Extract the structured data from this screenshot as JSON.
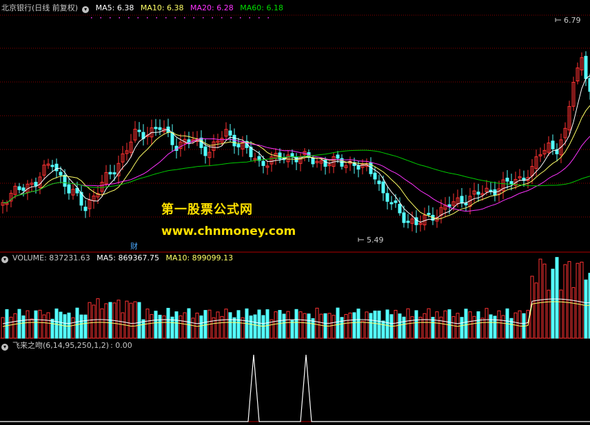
{
  "price_panel": {
    "stock_title": "北京银行(日线 前复权)",
    "indicators": [
      {
        "label": "MA5:",
        "value": "6.38",
        "color": "#ffffff"
      },
      {
        "label": "MA10:",
        "value": "6.38",
        "color": "#ffff66"
      },
      {
        "label": "MA20:",
        "value": "6.28",
        "color": "#ff33ff"
      },
      {
        "label": "MA60:",
        "value": "6.18",
        "color": "#00dd00"
      }
    ],
    "high_label": "6.79",
    "low_label": "5.49",
    "event_marker": "财"
  },
  "watermark": {
    "title": "第一股票公式网",
    "url": "www.chnmoney.com"
  },
  "volume_panel": {
    "label": "VOLUME: 837231.63",
    "ma5": "MA5: 869367.75",
    "ma10": "MA10: 899099.13"
  },
  "signal_panel": {
    "label": "飞来之吻(6,14,95,250,1,2)",
    "value": ": 0.00"
  },
  "colors": {
    "up": "#ff3232",
    "down": "#54ffff",
    "grid": "#8b0000",
    "divider": "#b00000",
    "ma5": "#ffffff",
    "ma10": "#ffff66",
    "ma20": "#ff33ff",
    "ma60": "#00cc00"
  }
}
